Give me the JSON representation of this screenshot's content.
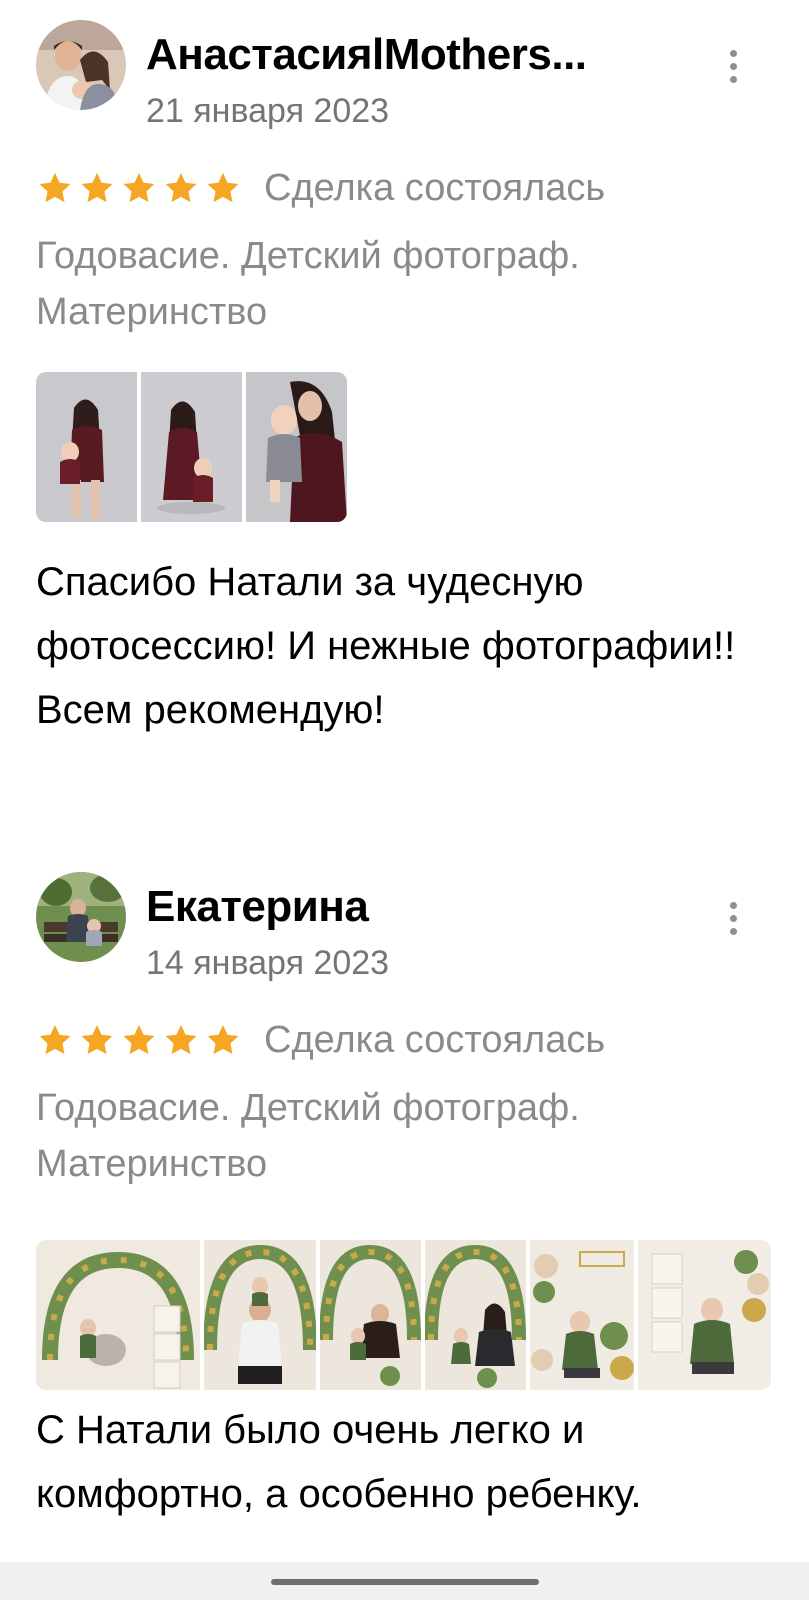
{
  "reviews": [
    {
      "author": "АнастасияlMothers...",
      "date": "21 января 2023",
      "rating": 5,
      "deal_status": "Сделка состоялась",
      "listing": "Годовасие. Детский фотограф. Материнство",
      "photo_count": 3,
      "text": "Спасибо Натали за чудесную фотосессию! И нежные фотографии!!    Всем рекомендую!"
    },
    {
      "author": "Екатерина",
      "date": "14 января 2023",
      "rating": 5,
      "deal_status": "Сделка состоялась",
      "listing": "Годовасие. Детский фотограф. Материнство",
      "photo_count": 6,
      "text": "С Натали было очень легко и комфортно, а особенно ребенку."
    }
  ],
  "icons": {
    "star": "star-icon",
    "more": "more-vertical-icon"
  },
  "colors": {
    "star": "#f5a623",
    "secondary_text": "#8a8a8a",
    "date_text": "#757575"
  }
}
